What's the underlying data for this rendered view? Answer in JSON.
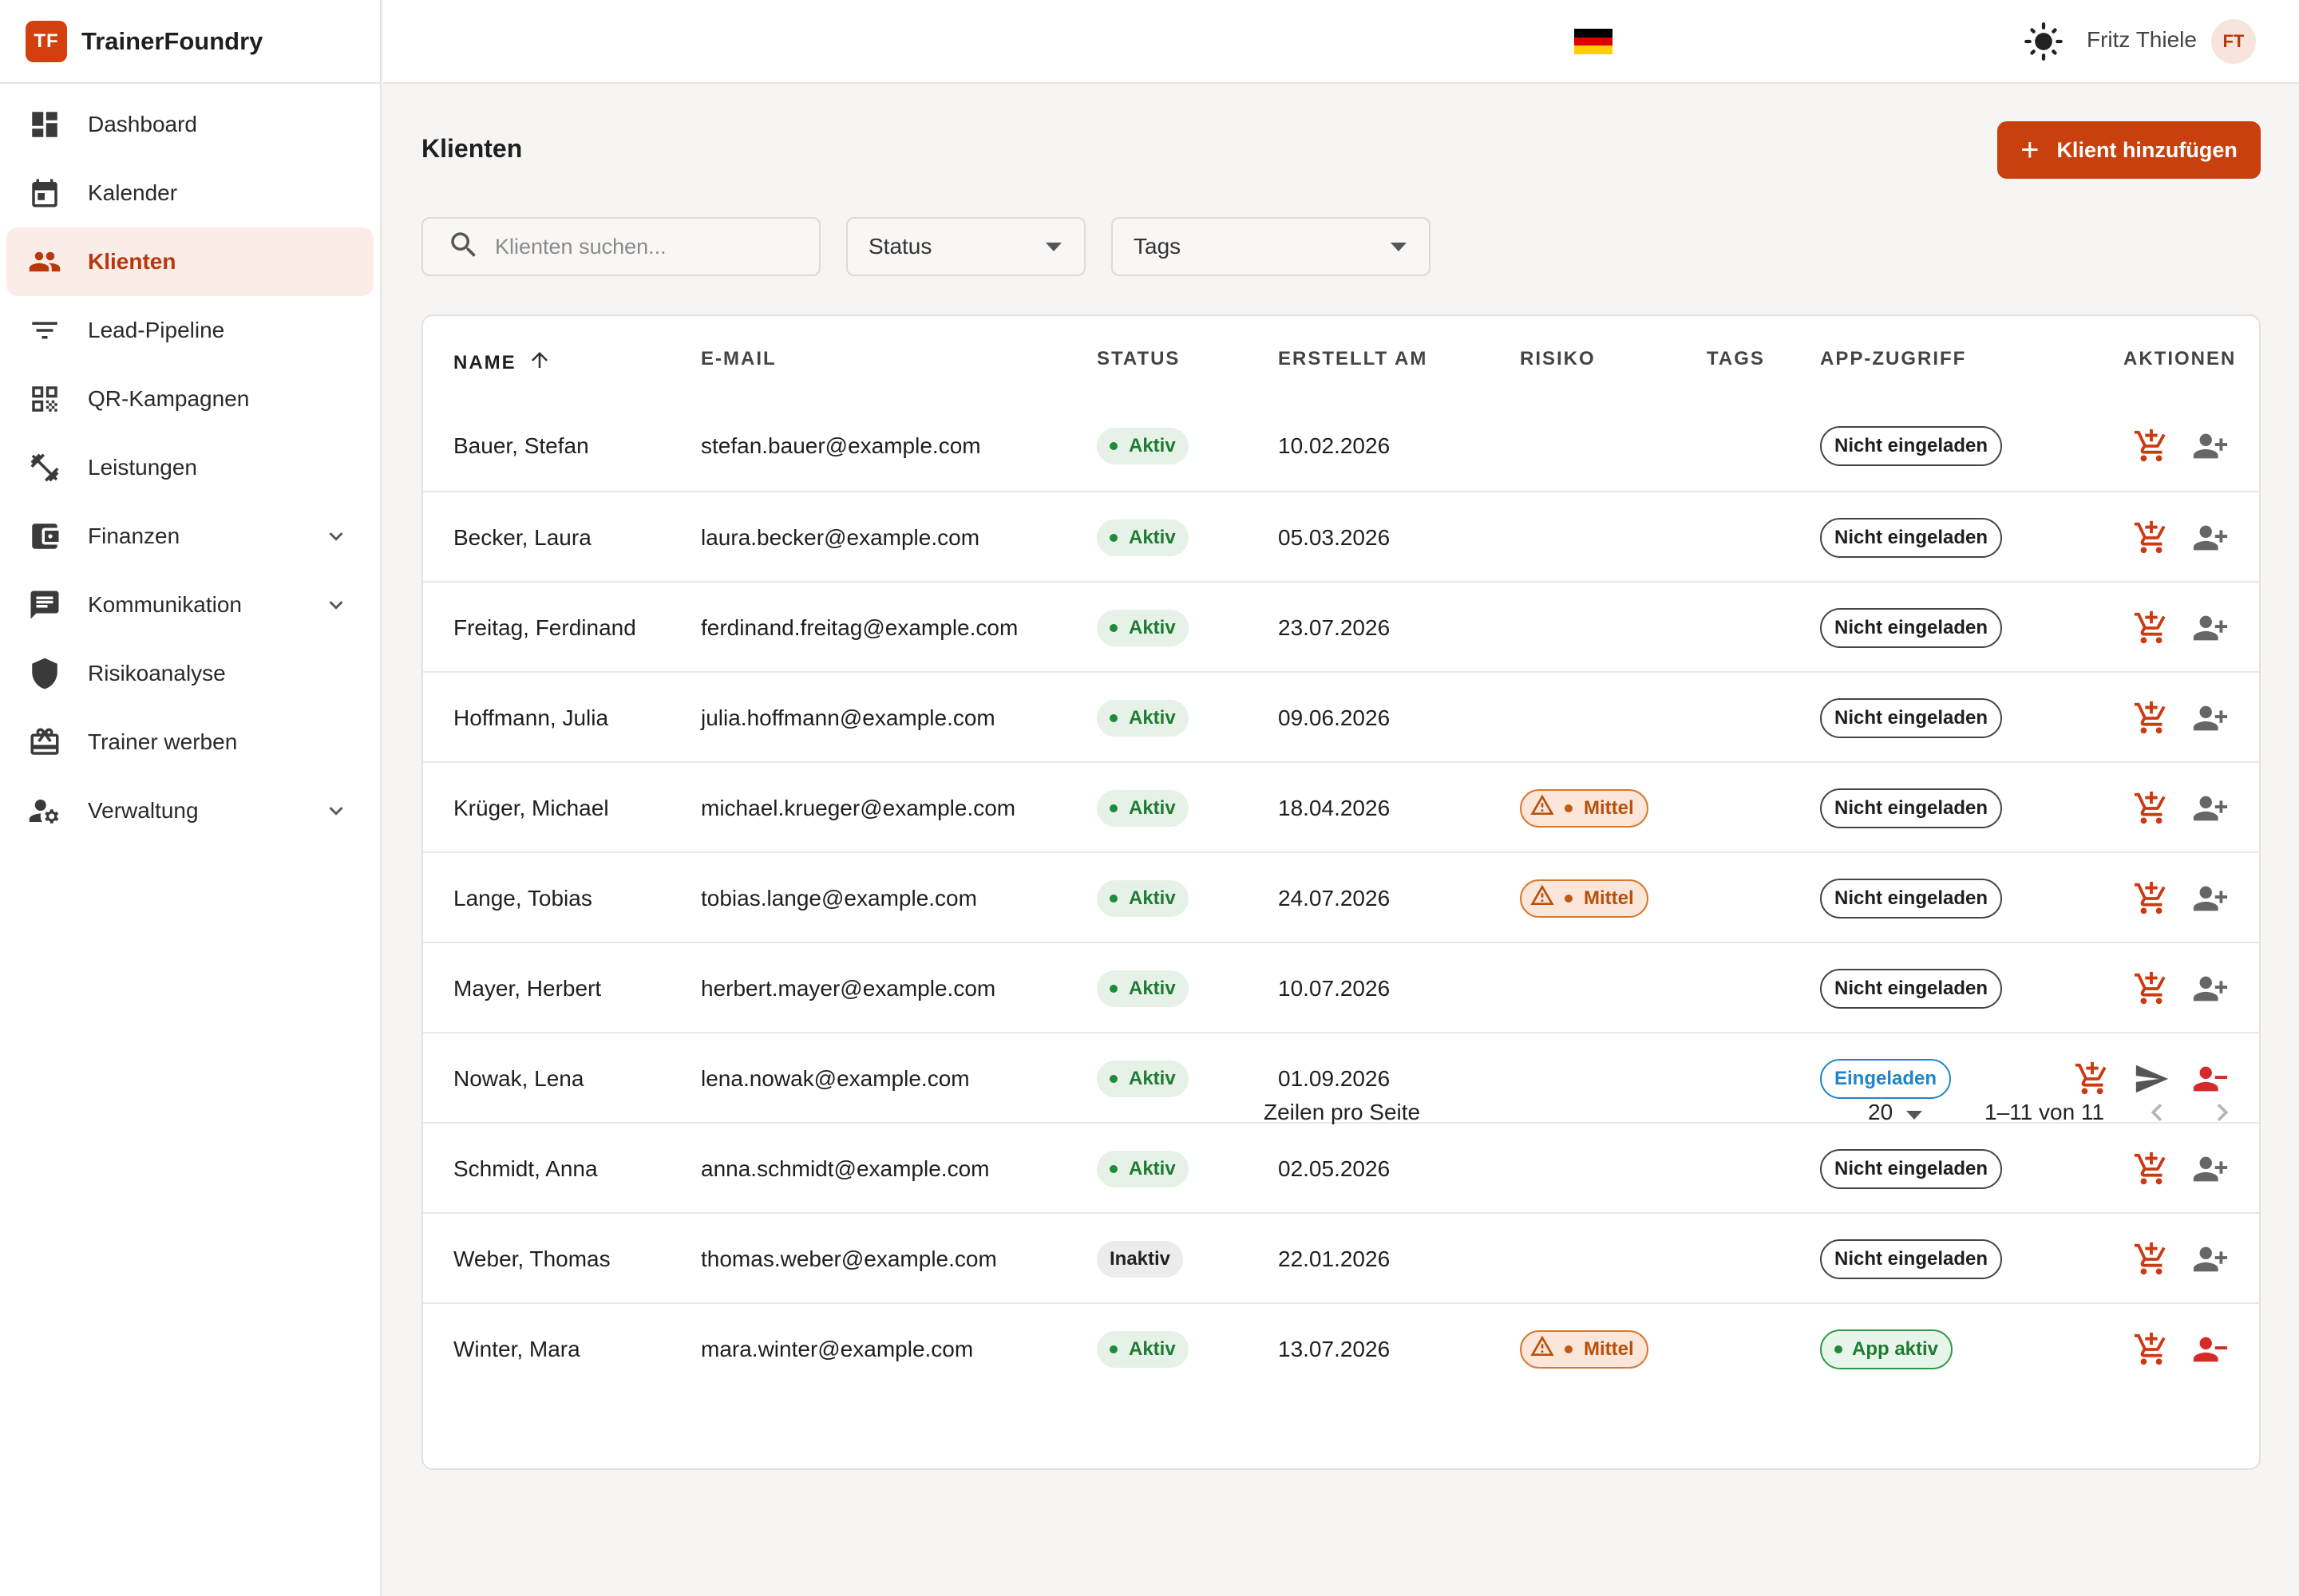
{
  "app": {
    "logo_text": "TF",
    "name": "TrainerFoundry"
  },
  "sidebar": {
    "items": [
      {
        "label": "Dashboard",
        "icon": "dashboard-icon"
      },
      {
        "label": "Kalender",
        "icon": "calendar-icon"
      },
      {
        "label": "Klienten",
        "icon": "people-icon",
        "active": true
      },
      {
        "label": "Lead-Pipeline",
        "icon": "filter-icon"
      },
      {
        "label": "QR-Kampagnen",
        "icon": "qr-code-icon"
      },
      {
        "label": "Leistungen",
        "icon": "dumbbell-icon"
      },
      {
        "label": "Finanzen",
        "icon": "wallet-icon",
        "expandable": true
      },
      {
        "label": "Kommunikation",
        "icon": "chat-icon",
        "expandable": true
      },
      {
        "label": "Risikoanalyse",
        "icon": "shield-icon"
      },
      {
        "label": "Trainer werben",
        "icon": "gift-card-icon"
      },
      {
        "label": "Verwaltung",
        "icon": "user-settings-icon",
        "expandable": true
      }
    ]
  },
  "topbar": {
    "language": "de",
    "theme_icon": "sun-icon",
    "user_name": "Fritz Thiele",
    "user_initials": "FT"
  },
  "page": {
    "title": "Klienten",
    "add_button": "Klient hinzufügen"
  },
  "filters": {
    "search_placeholder": "Klienten suchen...",
    "status_label": "Status",
    "tags_label": "Tags"
  },
  "table": {
    "columns": {
      "name": "NAME",
      "email": "E-MAIL",
      "status": "STATUS",
      "created": "ERSTELLT AM",
      "risk": "RISIKO",
      "tags": "TAGS",
      "app": "APP-ZUGRIFF",
      "actions": "AKTIONEN"
    },
    "rows": [
      {
        "name": "Bauer, Stefan",
        "email": "stefan.bauer@example.com",
        "status": "Aktiv",
        "created": "10.02.2026",
        "risk": "",
        "app": "Nicht eingeladen",
        "app_state": "none"
      },
      {
        "name": "Becker, Laura",
        "email": "laura.becker@example.com",
        "status": "Aktiv",
        "created": "05.03.2026",
        "risk": "",
        "app": "Nicht eingeladen",
        "app_state": "none"
      },
      {
        "name": "Freitag, Ferdinand",
        "email": "ferdinand.freitag@example.com",
        "status": "Aktiv",
        "created": "23.07.2026",
        "risk": "",
        "app": "Nicht eingeladen",
        "app_state": "none"
      },
      {
        "name": "Hoffmann, Julia",
        "email": "julia.hoffmann@example.com",
        "status": "Aktiv",
        "created": "09.06.2026",
        "risk": "",
        "app": "Nicht eingeladen",
        "app_state": "none"
      },
      {
        "name": "Krüger, Michael",
        "email": "michael.krueger@example.com",
        "status": "Aktiv",
        "created": "18.04.2026",
        "risk": "Mittel",
        "app": "Nicht eingeladen",
        "app_state": "none"
      },
      {
        "name": "Lange, Tobias",
        "email": "tobias.lange@example.com",
        "status": "Aktiv",
        "created": "24.07.2026",
        "risk": "Mittel",
        "app": "Nicht eingeladen",
        "app_state": "none"
      },
      {
        "name": "Mayer, Herbert",
        "email": "herbert.mayer@example.com",
        "status": "Aktiv",
        "created": "10.07.2026",
        "risk": "",
        "app": "Nicht eingeladen",
        "app_state": "none"
      },
      {
        "name": "Nowak, Lena",
        "email": "lena.nowak@example.com",
        "status": "Aktiv",
        "created": "01.09.2026",
        "risk": "",
        "app": "Eingeladen",
        "app_state": "invited"
      },
      {
        "name": "Schmidt, Anna",
        "email": "anna.schmidt@example.com",
        "status": "Aktiv",
        "created": "02.05.2026",
        "risk": "",
        "app": "Nicht eingeladen",
        "app_state": "none"
      },
      {
        "name": "Weber, Thomas",
        "email": "thomas.weber@example.com",
        "status": "Inaktiv",
        "created": "22.01.2026",
        "risk": "",
        "app": "Nicht eingeladen",
        "app_state": "none"
      },
      {
        "name": "Winter, Mara",
        "email": "mara.winter@example.com",
        "status": "Aktiv",
        "created": "13.07.2026",
        "risk": "Mittel",
        "app": "App aktiv",
        "app_state": "active"
      }
    ]
  },
  "pagination": {
    "rows_per_page_label": "Zeilen pro Seite",
    "rows_per_page": "20",
    "range": "1–11 von 11"
  },
  "colors": {
    "brand": "#c9400f",
    "active_nav_bg": "#fbece7",
    "status_active": "#1f7a33",
    "risk": "#b8500c",
    "invited": "#1e86c8"
  }
}
